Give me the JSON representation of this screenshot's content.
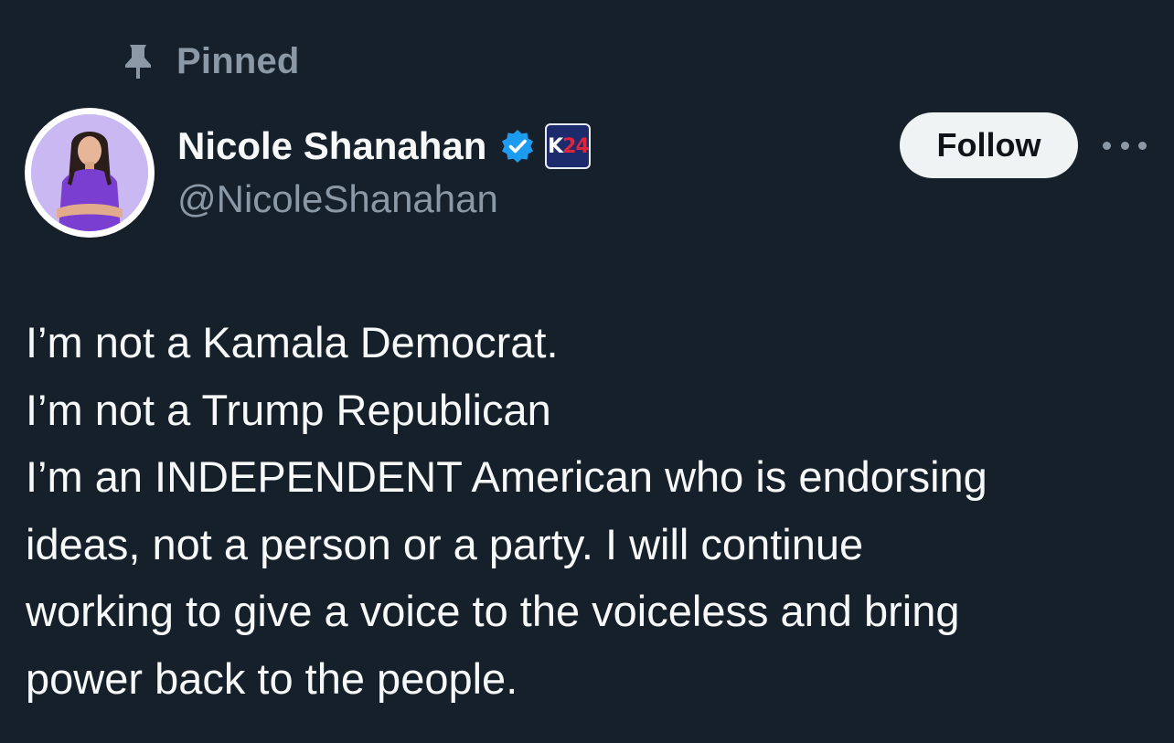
{
  "pinned": {
    "icon": "pin-icon",
    "label": "Pinned"
  },
  "author": {
    "display_name": "Nicole Shanahan",
    "handle": "@NicoleShanahan",
    "avatar_icon": "avatar",
    "verified_icon": "verified-badge-icon",
    "affiliate_badge": {
      "part1": "K",
      "part2": "24"
    }
  },
  "actions": {
    "follow_label": "Follow",
    "more_icon": "more-options-icon"
  },
  "tweet": {
    "lines": [
      "I’m not a Kamala Democrat.",
      "I’m not a Trump Republican",
      "I’m an INDEPENDENT American who is endorsing",
      "ideas, not a person or a party. I will continue",
      "working to give a voice to the voiceless and bring",
      "power back to the people."
    ]
  },
  "colors": {
    "background": "#15202b",
    "primary_text": "#f7f9f9",
    "secondary_text": "#8b98a5",
    "verified_blue": "#1d9bf0",
    "follow_button_bg": "#eff3f4",
    "avatar_purple": "#c9b8f2"
  }
}
